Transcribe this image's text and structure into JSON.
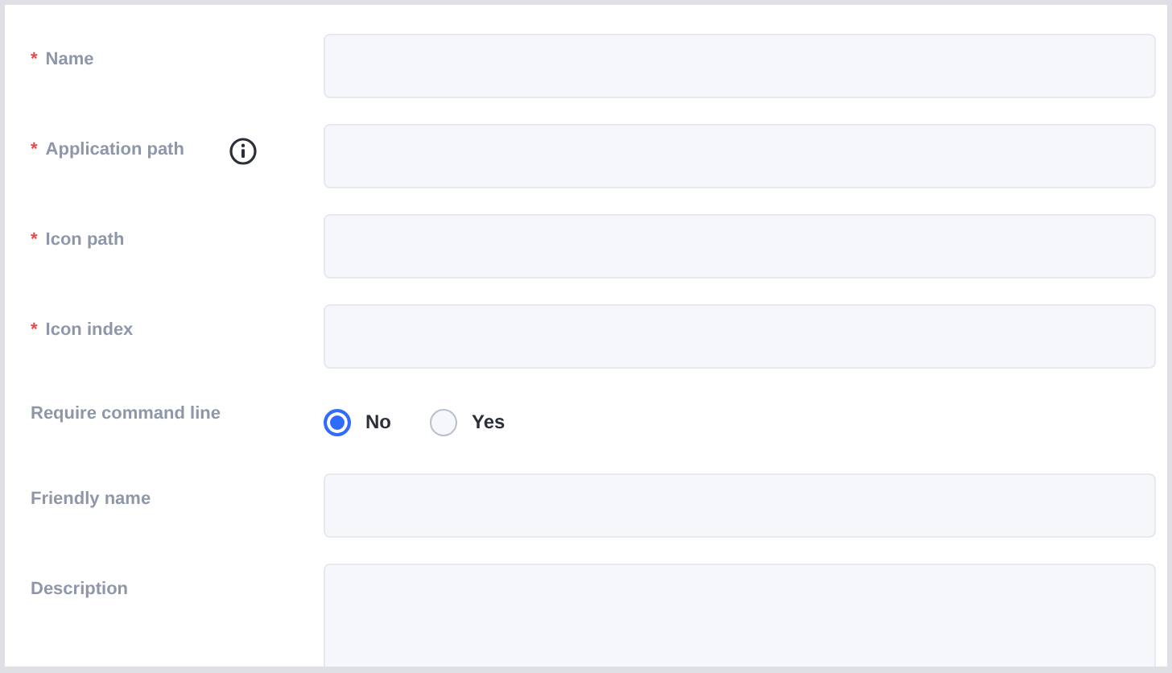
{
  "fields": [
    {
      "kind": "text",
      "label": "Name",
      "marker": "*"
    },
    {
      "kind": "text",
      "label": "Application path",
      "marker": "*",
      "info": true
    },
    {
      "kind": "text",
      "label": "Icon path",
      "marker": "*"
    },
    {
      "kind": "text",
      "label": "Icon index",
      "marker": "*"
    },
    {
      "kind": "radio",
      "label": "Require command line",
      "options": [
        {
          "label": "No",
          "selected": true
        },
        {
          "label": "Yes",
          "selected": false
        }
      ]
    },
    {
      "kind": "text",
      "label": "Friendly name"
    },
    {
      "kind": "textarea",
      "label": "Description"
    }
  ]
}
